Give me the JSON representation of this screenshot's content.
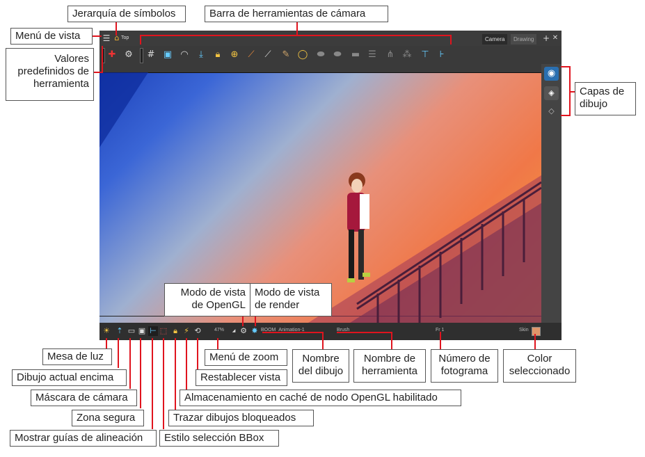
{
  "window": {
    "scene_name": "Top",
    "tabs": [
      "Camera",
      "Drawing"
    ],
    "add_tab": "+",
    "close_tab": "✕"
  },
  "toolbar": {
    "icons": [
      "tool-preset-add-icon",
      "gear-icon",
      "grid-icon",
      "camera-icon",
      "onion-skin-icon",
      "light-table-icon",
      "lock-icon",
      "lock-alt-icon",
      "ruler-icon",
      "ruler-alt-icon",
      "pencil-icon",
      "mirror-icon",
      "disc-icon",
      "disc-alt-icon",
      "layers-icon",
      "layers-alt-icon",
      "tree-icon",
      "tree-alt-icon",
      "guide-icon",
      "guide-alt-icon"
    ]
  },
  "statusbar": {
    "zoom": "47%",
    "drawing_name": "BOOM_Animation-1",
    "tool_name": "Brush",
    "frame": "Fr 1",
    "color_name": "Skin",
    "color_swatch": "#e0966a"
  },
  "callouts": {
    "symbol_hierarchy": "Jerarquía de símbolos",
    "camera_toolbar": "Barra de herramientas de cámara",
    "view_menu": "Menú de vista",
    "tool_presets": "Valores predefinidos de herramienta",
    "drawing_layers": "Capas de dibujo",
    "opengl_view_mode": "Modo de vista de OpenGL",
    "render_view_mode": "Modo de vista de render",
    "light_table": "Mesa de luz",
    "current_drawing_on_top": "Dibujo actual encima",
    "camera_mask": "Máscara de cámara",
    "safe_area": "Zona segura",
    "show_alignment_guides": "Mostrar guías de alineación",
    "bbox_selection_style": "Estilo selección BBox",
    "outline_locked_drawings": "Trazar dibujos bloqueados",
    "opengl_cache": "Almacenamiento en caché de nodo OpenGL habilitado",
    "reset_view": "Restablecer vista",
    "zoom_menu": "Menú de zoom",
    "drawing_name": "Nombre del dibujo",
    "tool_name": "Nombre de herramienta",
    "frame_number": "Número de fotograma",
    "selected_color": "Color seleccionado"
  }
}
